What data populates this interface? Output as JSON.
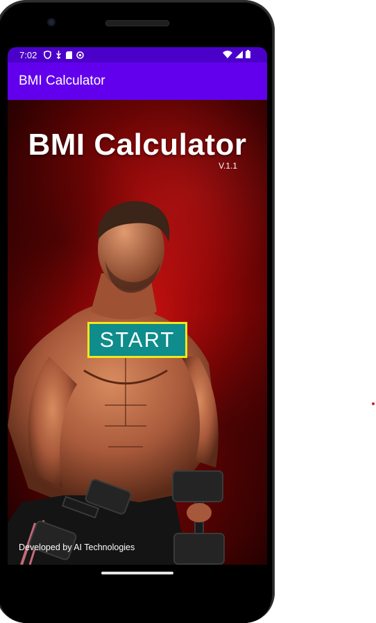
{
  "status_bar": {
    "time": "7:02",
    "left_icons": [
      "shield-icon",
      "usb-debug-icon",
      "sd-card-icon",
      "notification-face-icon"
    ],
    "right_icons": [
      "wifi-icon",
      "signal-icon",
      "battery-icon"
    ]
  },
  "app_bar": {
    "title": "BMI Calculator"
  },
  "hero": {
    "title": "BMI Calculator",
    "version": "V.1.1"
  },
  "start_button": {
    "label": "START"
  },
  "footer": {
    "text": "Developed by AI Technologies"
  },
  "colors": {
    "status_bar": "#4b00c9",
    "app_bar": "#6200ee",
    "start_button_bg": "#0f8c8c",
    "start_button_border": "#f1e71b",
    "background_red": "#b00d0d"
  }
}
